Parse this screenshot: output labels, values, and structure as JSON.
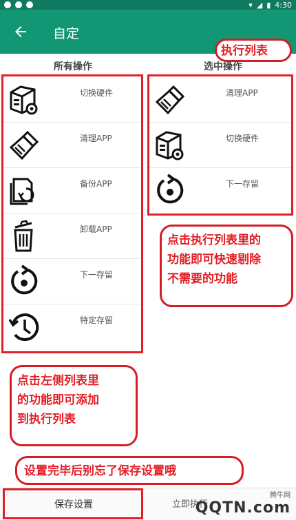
{
  "status": {
    "time": "4:30"
  },
  "appbar": {
    "title": "自定"
  },
  "left_panel": {
    "title": "所有操作",
    "items": [
      {
        "label": "切换硬件",
        "icon": "hardware-switch-icon"
      },
      {
        "label": "清理APP",
        "icon": "broom-icon"
      },
      {
        "label": "备份APP",
        "icon": "backup-icon"
      },
      {
        "label": "卸载APP",
        "icon": "trash-icon"
      },
      {
        "label": "下一存留",
        "icon": "rotate-icon"
      },
      {
        "label": "特定存留",
        "icon": "history-icon"
      }
    ]
  },
  "right_panel": {
    "title": "选中操作",
    "items": [
      {
        "label": "清理APP",
        "icon": "broom-icon"
      },
      {
        "label": "切换硬件",
        "icon": "hardware-switch-icon"
      },
      {
        "label": "下一存留",
        "icon": "rotate-icon"
      }
    ]
  },
  "annotations": {
    "exec_list": "执行列表",
    "right_note": [
      "点击执行列表里的",
      "功能即可快速剔除",
      "不需要的功能"
    ],
    "left_note": [
      "点击左侧列表里",
      "的功能即可添加",
      "到执行列表"
    ],
    "save_note": "设置完毕后别忘了保存设置哦"
  },
  "bottom": {
    "save_label": "保存设置",
    "exec_label": "立即执行",
    "watermark_small": "腾牛网",
    "watermark_big": "QQTN.com"
  },
  "colors": {
    "appbar": "#129674",
    "status": "#0e7b60",
    "annotation_red": "#e21f26"
  }
}
